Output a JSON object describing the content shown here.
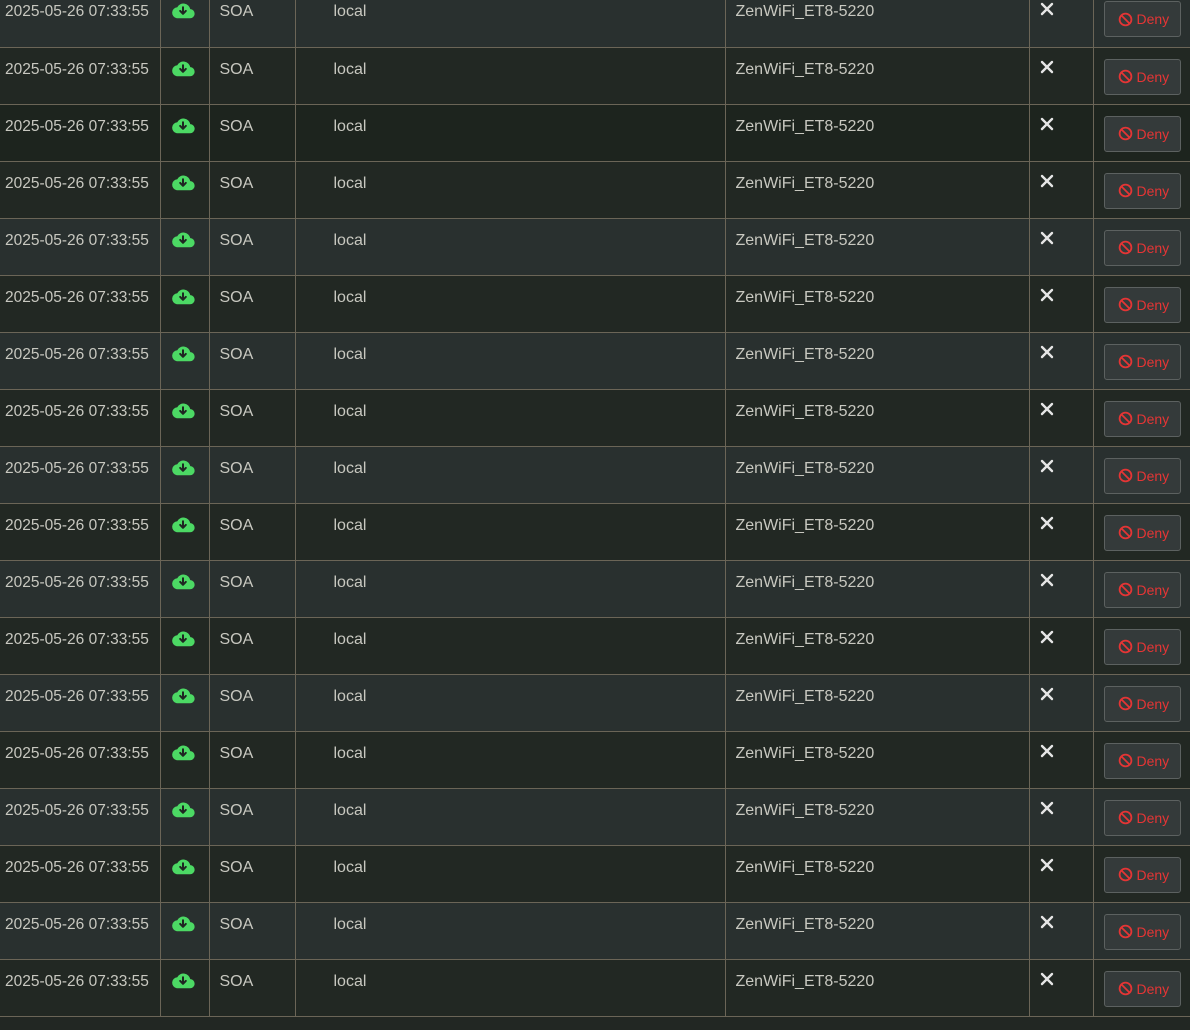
{
  "colors": {
    "status_icon": "#4cd964",
    "deny": "#e53535",
    "text": "#c8c8c0",
    "grid": "#6b6557"
  },
  "icons": {
    "status": "cloud-download-icon",
    "remove": "close-icon",
    "deny": "block-icon"
  },
  "rows": [
    {
      "time": "2025-05-26 07:33:55",
      "type": "SOA",
      "domain": "local",
      "client": "ZenWiFi_ET8-5220",
      "deny_label": "Deny"
    },
    {
      "time": "2025-05-26 07:33:55",
      "type": "SOA",
      "domain": "local",
      "client": "ZenWiFi_ET8-5220",
      "deny_label": "Deny"
    },
    {
      "time": "2025-05-26 07:33:55",
      "type": "SOA",
      "domain": "local",
      "client": "ZenWiFi_ET8-5220",
      "deny_label": "Deny"
    },
    {
      "time": "2025-05-26 07:33:55",
      "type": "SOA",
      "domain": "local",
      "client": "ZenWiFi_ET8-5220",
      "deny_label": "Deny"
    },
    {
      "time": "2025-05-26 07:33:55",
      "type": "SOA",
      "domain": "local",
      "client": "ZenWiFi_ET8-5220",
      "deny_label": "Deny"
    },
    {
      "time": "2025-05-26 07:33:55",
      "type": "SOA",
      "domain": "local",
      "client": "ZenWiFi_ET8-5220",
      "deny_label": "Deny"
    },
    {
      "time": "2025-05-26 07:33:55",
      "type": "SOA",
      "domain": "local",
      "client": "ZenWiFi_ET8-5220",
      "deny_label": "Deny"
    },
    {
      "time": "2025-05-26 07:33:55",
      "type": "SOA",
      "domain": "local",
      "client": "ZenWiFi_ET8-5220",
      "deny_label": "Deny"
    },
    {
      "time": "2025-05-26 07:33:55",
      "type": "SOA",
      "domain": "local",
      "client": "ZenWiFi_ET8-5220",
      "deny_label": "Deny"
    },
    {
      "time": "2025-05-26 07:33:55",
      "type": "SOA",
      "domain": "local",
      "client": "ZenWiFi_ET8-5220",
      "deny_label": "Deny"
    },
    {
      "time": "2025-05-26 07:33:55",
      "type": "SOA",
      "domain": "local",
      "client": "ZenWiFi_ET8-5220",
      "deny_label": "Deny"
    },
    {
      "time": "2025-05-26 07:33:55",
      "type": "SOA",
      "domain": "local",
      "client": "ZenWiFi_ET8-5220",
      "deny_label": "Deny"
    },
    {
      "time": "2025-05-26 07:33:55",
      "type": "SOA",
      "domain": "local",
      "client": "ZenWiFi_ET8-5220",
      "deny_label": "Deny"
    },
    {
      "time": "2025-05-26 07:33:55",
      "type": "SOA",
      "domain": "local",
      "client": "ZenWiFi_ET8-5220",
      "deny_label": "Deny"
    },
    {
      "time": "2025-05-26 07:33:55",
      "type": "SOA",
      "domain": "local",
      "client": "ZenWiFi_ET8-5220",
      "deny_label": "Deny"
    },
    {
      "time": "2025-05-26 07:33:55",
      "type": "SOA",
      "domain": "local",
      "client": "ZenWiFi_ET8-5220",
      "deny_label": "Deny"
    },
    {
      "time": "2025-05-26 07:33:55",
      "type": "SOA",
      "domain": "local",
      "client": "ZenWiFi_ET8-5220",
      "deny_label": "Deny"
    },
    {
      "time": "2025-05-26 07:33:55",
      "type": "SOA",
      "domain": "local",
      "client": "ZenWiFi_ET8-5220",
      "deny_label": "Deny"
    }
  ]
}
